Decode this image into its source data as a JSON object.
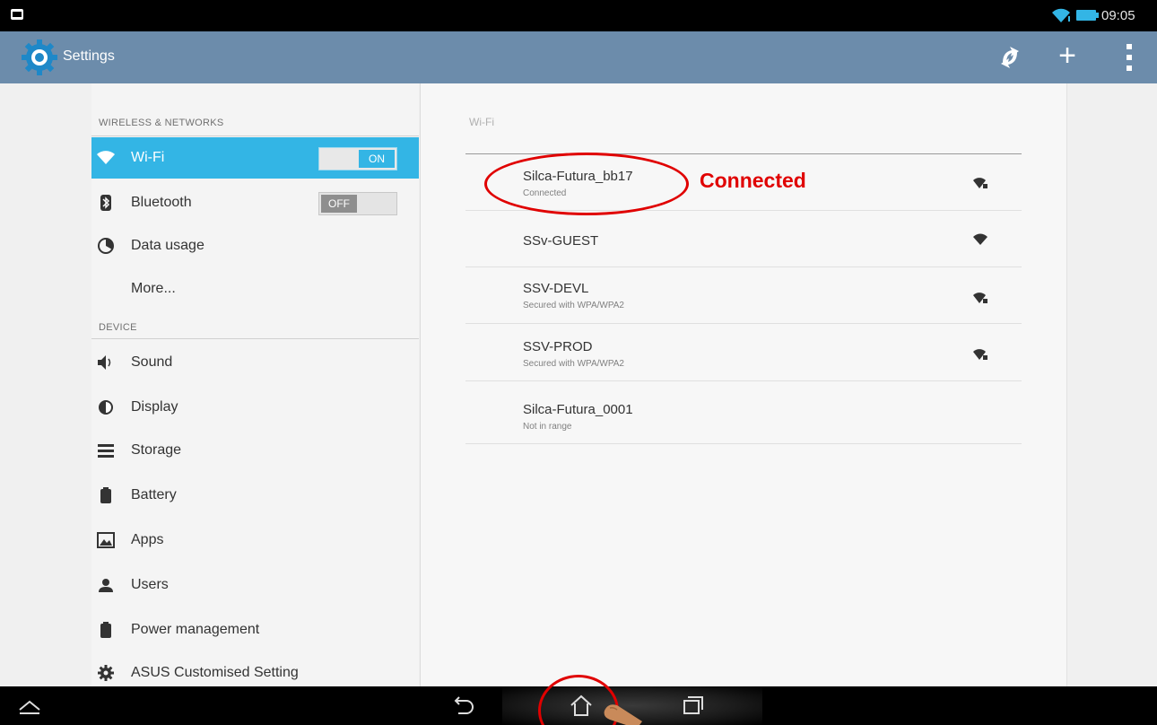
{
  "status_bar": {
    "time": "09:05",
    "icons": [
      "notification-icon",
      "wifi-icon",
      "battery-icon"
    ]
  },
  "action_bar": {
    "title": "Settings",
    "actions": [
      "sync-icon",
      "add-icon",
      "overflow-menu-icon"
    ]
  },
  "sidebar": {
    "sections": [
      {
        "header": "WIRELESS & NETWORKS",
        "items": [
          {
            "label": "Wi-Fi",
            "icon": "wifi-icon",
            "selected": true,
            "toggle": "ON"
          },
          {
            "label": "Bluetooth",
            "icon": "bluetooth-icon",
            "toggle": "OFF"
          },
          {
            "label": "Data usage",
            "icon": "data-usage-icon"
          },
          {
            "label": "More...",
            "icon": ""
          }
        ]
      },
      {
        "header": "DEVICE",
        "items": [
          {
            "label": "Sound",
            "icon": "speaker-icon"
          },
          {
            "label": "Display",
            "icon": "brightness-icon"
          },
          {
            "label": "Storage",
            "icon": "storage-icon"
          },
          {
            "label": "Battery",
            "icon": "battery-icon"
          },
          {
            "label": "Apps",
            "icon": "apps-icon"
          },
          {
            "label": "Users",
            "icon": "user-icon"
          },
          {
            "label": "Power management",
            "icon": "power-icon"
          },
          {
            "label": "ASUS Customised Setting",
            "icon": "gear-icon"
          }
        ]
      }
    ]
  },
  "wifi_panel": {
    "title": "Wi-Fi",
    "networks": [
      {
        "name": "Silca-Futura_bb17",
        "status": "Connected",
        "signal": "wifi-signal-locked-icon"
      },
      {
        "name": "SSv-GUEST",
        "status": "",
        "signal": "wifi-signal-icon"
      },
      {
        "name": "SSV-DEVL",
        "status": "Secured with WPA/WPA2",
        "signal": "wifi-signal-locked-icon"
      },
      {
        "name": "SSV-PROD",
        "status": "Secured with WPA/WPA2",
        "signal": "wifi-signal-locked-icon"
      },
      {
        "name": "Silca-Futura_0001",
        "status": "Not in range",
        "signal": ""
      }
    ]
  },
  "annotation": {
    "label": "Connected",
    "color": "#e00000"
  },
  "nav_bar": {
    "buttons": [
      "hide-bar-icon",
      "back-icon",
      "home-icon",
      "recent-apps-icon"
    ]
  },
  "colors": {
    "action_bar": "#6c8cab",
    "accent": "#33b5e5",
    "annotation": "#e00000"
  }
}
